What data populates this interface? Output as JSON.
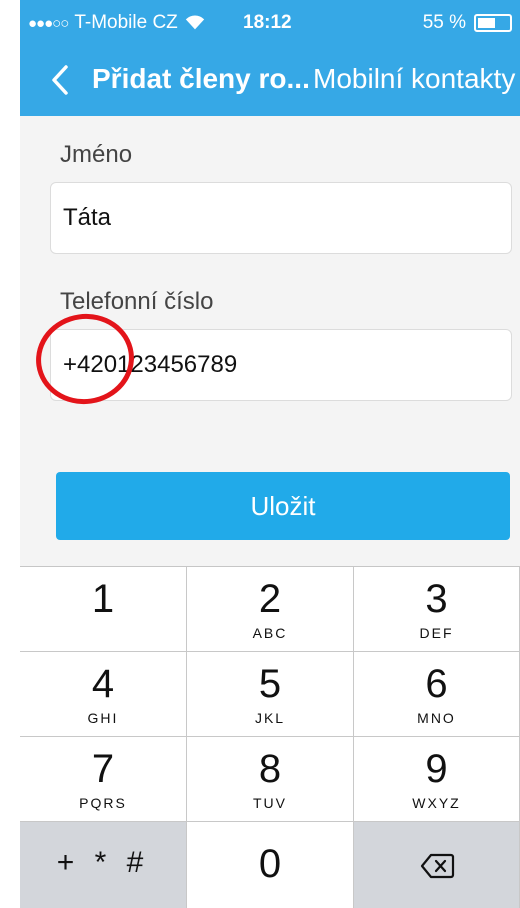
{
  "status_bar": {
    "carrier": "T-Mobile CZ",
    "signal": "●●●○○",
    "time": "18:12",
    "battery": "55 %",
    "battery_level": 0.55
  },
  "nav": {
    "title": "Přidat členy ro...",
    "right_action": "Mobilní kontakty"
  },
  "form": {
    "name_label": "Jméno",
    "name_value": "Táta",
    "phone_label": "Telefonní číslo",
    "phone_value": "+420123456789",
    "save_label": "Uložit"
  },
  "keypad": {
    "keys": [
      {
        "digit": "1",
        "letters": ""
      },
      {
        "digit": "2",
        "letters": "ABC"
      },
      {
        "digit": "3",
        "letters": "DEF"
      },
      {
        "digit": "4",
        "letters": "GHI"
      },
      {
        "digit": "5",
        "letters": "JKL"
      },
      {
        "digit": "6",
        "letters": "MNO"
      },
      {
        "digit": "7",
        "letters": "PQRS"
      },
      {
        "digit": "8",
        "letters": "TUV"
      },
      {
        "digit": "9",
        "letters": "WXYZ"
      }
    ],
    "symbols": "+ * #",
    "zero": "0"
  },
  "colors": {
    "header": "#36a8e6",
    "save_button": "#21aae9",
    "annotation": "#e3141a"
  }
}
